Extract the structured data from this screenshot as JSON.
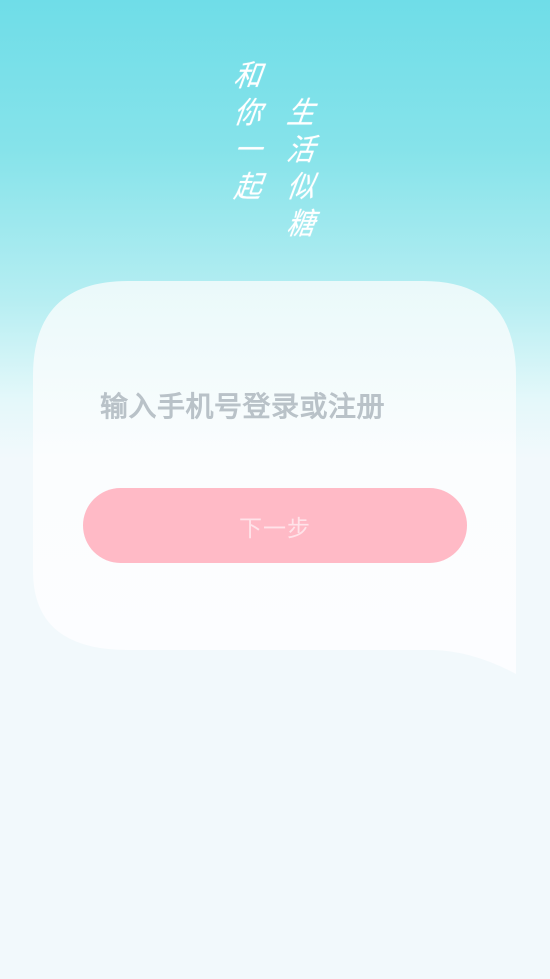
{
  "slogan": {
    "left_column": [
      "和",
      "你",
      "一",
      "起"
    ],
    "right_column": [
      "生",
      "活",
      "似",
      "糖"
    ]
  },
  "login": {
    "prompt": "输入手机号登录或注册",
    "next_button_label": "下一步"
  },
  "colors": {
    "background_top": "#6fdde8",
    "background_bottom": "#f2f9fc",
    "card": "#fbfdfe",
    "prompt_text": "#b9c2c8",
    "button": "#ffbac6",
    "button_text": "#ffe3e9"
  }
}
